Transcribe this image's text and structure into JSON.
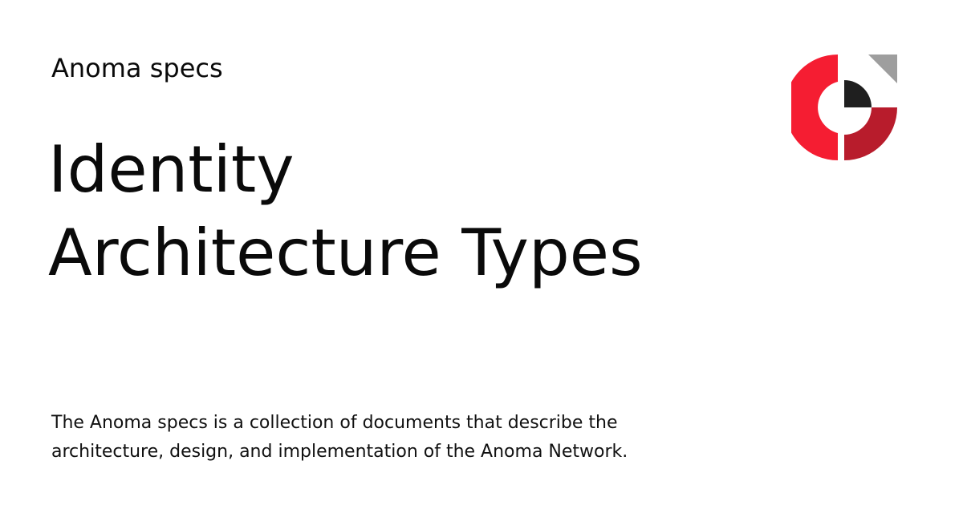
{
  "header": {
    "site_name": "Anoma specs"
  },
  "title": {
    "line1": "Identity",
    "line2": "Architecture Types"
  },
  "description": {
    "line1": "The Anoma specs is a collection of documents that describe the",
    "line2": "architecture, design, and implementation of the Anoma Network."
  },
  "logo": {
    "icon": "anoma-logo-icon",
    "colors": {
      "red_primary": "#f51d32",
      "red_dark": "#b81c2c",
      "black": "#1f1f1f",
      "gray": "#9e9e9e"
    }
  }
}
